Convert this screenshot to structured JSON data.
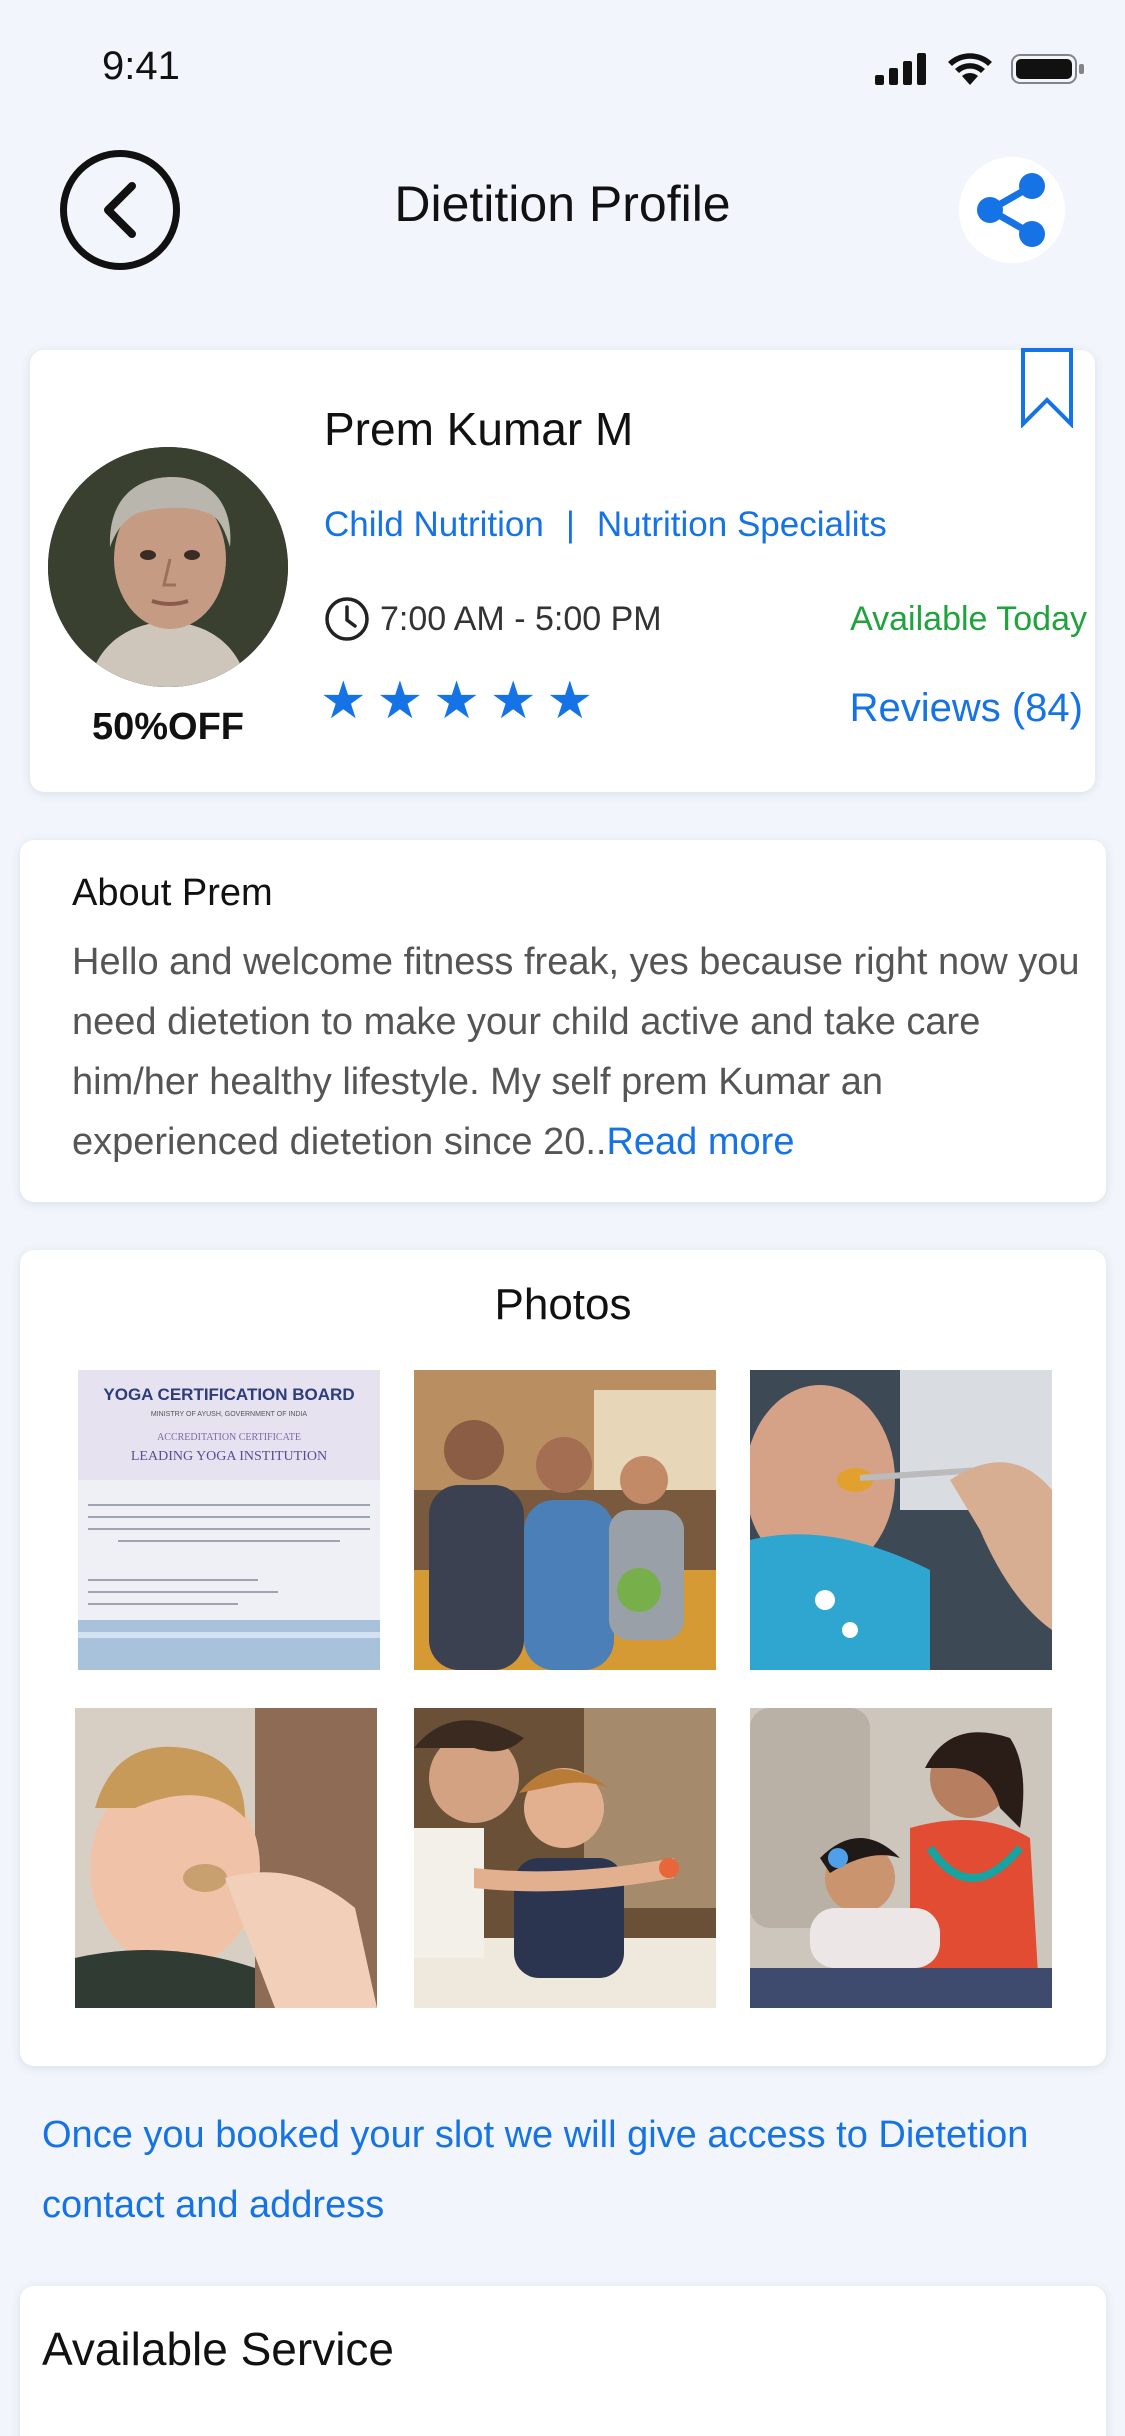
{
  "status": {
    "time": "9:41"
  },
  "header": {
    "title": "Dietition Profile"
  },
  "profile": {
    "name": "Prem Kumar M",
    "specialties": [
      "Child Nutrition",
      "Nutrition Specialits"
    ],
    "separator": "|",
    "hours": "7:00 AM - 5:00 PM",
    "availability": "Available Today",
    "rating": 5,
    "reviews": "Reviews (84)",
    "discount": "50%OFF"
  },
  "about": {
    "title": "About Prem",
    "text": "Hello and welcome fitness freak, yes because right now you need dietetion to make your child active and take care him/her healthy lifestyle. My self prem Kumar an experienced dietetion since 20..",
    "read_more": "Read more"
  },
  "photos": {
    "title": "Photos",
    "certificate": {
      "board": "YOGA CERTIFICATION BOARD",
      "ministry": "MINISTRY OF AYUSH, GOVERNMENT OF INDIA",
      "heading": "ACCREDITATION CERTIFICATE",
      "subtitle": "LEADING YOGA INSTITUTION"
    }
  },
  "booking_note": "Once you booked your slot we will give access to Dietetion contact and address",
  "service": {
    "title": "Available Service"
  },
  "colors": {
    "accent": "#1673e6",
    "available": "#1fa33d",
    "background": "#f2f6fc"
  }
}
